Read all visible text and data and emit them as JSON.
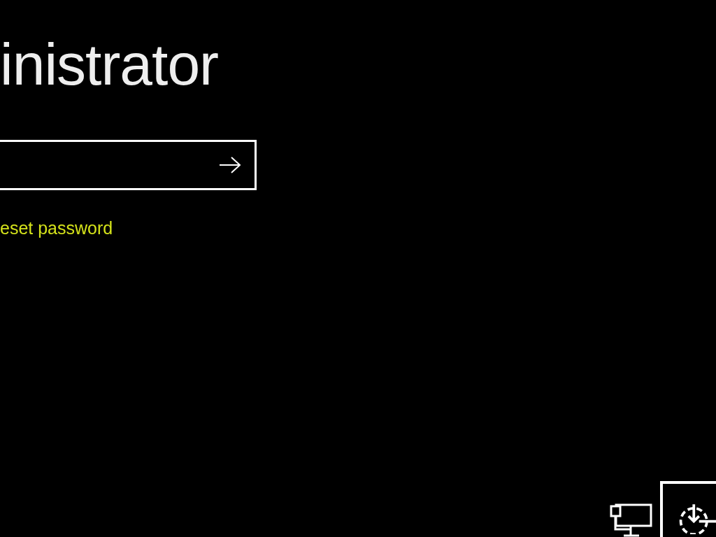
{
  "user_name": "inistrator",
  "reset_link": "eset password"
}
